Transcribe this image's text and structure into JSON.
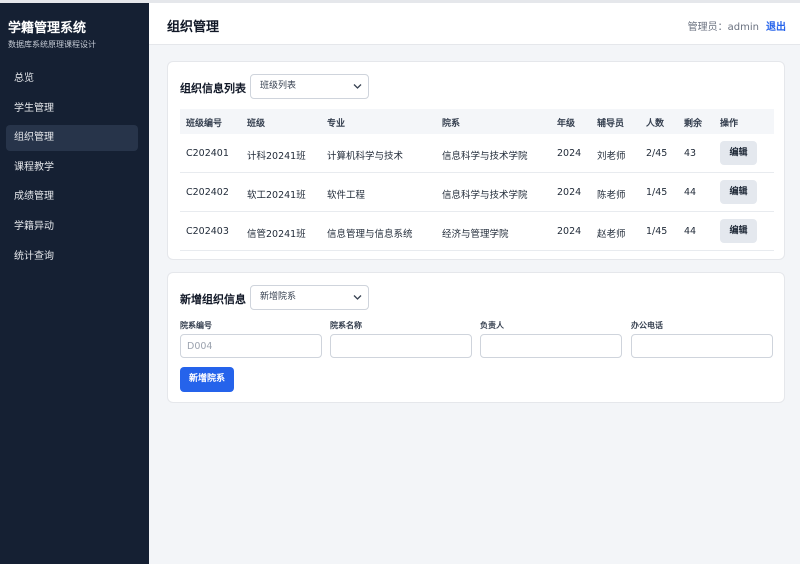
{
  "sidebar": {
    "title": "学籍管理系统",
    "subtitle": "数据库系统原理课程设计",
    "items": [
      {
        "label": "总览",
        "active": false
      },
      {
        "label": "学生管理",
        "active": false
      },
      {
        "label": "组织管理",
        "active": true
      },
      {
        "label": "课程教学",
        "active": false
      },
      {
        "label": "成绩管理",
        "active": false
      },
      {
        "label": "学籍异动",
        "active": false
      },
      {
        "label": "统计查询",
        "active": false
      }
    ]
  },
  "header": {
    "title": "组织管理",
    "admin_label": "管理员：admin",
    "logout_label": "退出"
  },
  "list_card": {
    "title": "组织信息列表",
    "select_value": "班级列表",
    "columns": [
      "班级编号",
      "班级",
      "专业",
      "院系",
      "年级",
      "辅导员",
      "人数",
      "剩余",
      "操作"
    ],
    "rows": [
      {
        "id": "C202401",
        "class": "计科20241班",
        "major": "计算机科学与技术",
        "dept": "信息科学与技术学院",
        "grade": "2024",
        "counselor": "刘老师",
        "count": "2/45",
        "remain": "43",
        "action": "编辑"
      },
      {
        "id": "C202402",
        "class": "软工20241班",
        "major": "软件工程",
        "dept": "信息科学与技术学院",
        "grade": "2024",
        "counselor": "陈老师",
        "count": "1/45",
        "remain": "44",
        "action": "编辑"
      },
      {
        "id": "C202403",
        "class": "信管20241班",
        "major": "信息管理与信息系统",
        "dept": "经济与管理学院",
        "grade": "2024",
        "counselor": "赵老师",
        "count": "1/45",
        "remain": "44",
        "action": "编辑"
      }
    ]
  },
  "add_card": {
    "title": "新增组织信息",
    "select_value": "新增院系",
    "fields": [
      {
        "label": "院系编号",
        "value": "",
        "placeholder": "D004"
      },
      {
        "label": "院系名称",
        "value": "",
        "placeholder": ""
      },
      {
        "label": "负责人",
        "value": "",
        "placeholder": ""
      },
      {
        "label": "办公电话",
        "value": "",
        "placeholder": ""
      }
    ],
    "submit_label": "新增院系"
  },
  "colors": {
    "sidebar_bg": "#152033",
    "sidebar_active": "#27344a",
    "accent": "#2563eb",
    "page_bg": "#f3f5f8"
  }
}
